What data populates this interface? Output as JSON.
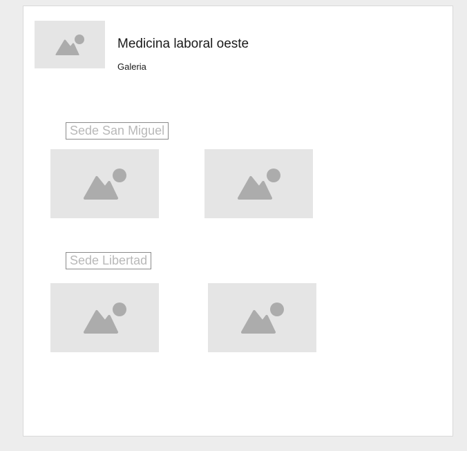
{
  "header": {
    "title": "Medicina laboral oeste",
    "subtitle": "Galeria",
    "logo_icon": "image-placeholder-icon"
  },
  "sections": [
    {
      "label": "Sede San Miguel",
      "images": [
        "image-placeholder-icon",
        "image-placeholder-icon"
      ]
    },
    {
      "label": "Sede Libertad",
      "images": [
        "image-placeholder-icon",
        "image-placeholder-icon"
      ]
    }
  ],
  "colors": {
    "page_background": "#ededed",
    "card_background": "#ffffff",
    "placeholder_fill": "#e5e5e5",
    "placeholder_icon": "#acacac",
    "label_text": "#b8b8b8"
  }
}
